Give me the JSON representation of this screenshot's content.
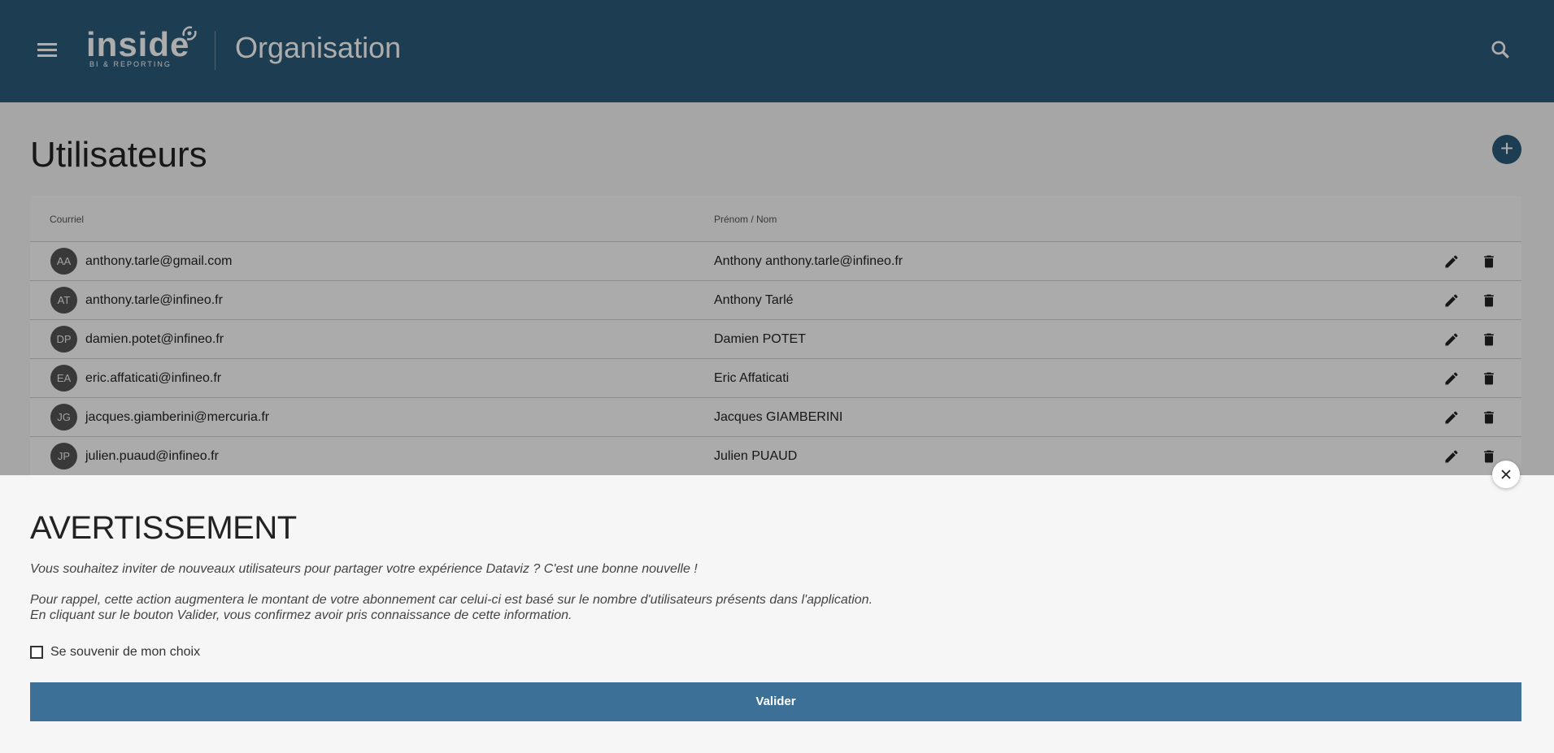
{
  "header": {
    "logo_text": "inside",
    "logo_subtitle": "BI & REPORTING",
    "page_name": "Organisation",
    "color": "#2a5a7a"
  },
  "main": {
    "title": "Utilisateurs",
    "add_label": "+",
    "columns": [
      "Courriel",
      "Prénom / Nom"
    ],
    "rows": [
      {
        "initials": "AA",
        "email": "anthony.tarle@gmail.com",
        "name": "Anthony anthony.tarle@infineo.fr"
      },
      {
        "initials": "AT",
        "email": "anthony.tarle@infineo.fr",
        "name": "Anthony Tarlé"
      },
      {
        "initials": "DP",
        "email": "damien.potet@infineo.fr",
        "name": "Damien POTET"
      },
      {
        "initials": "EA",
        "email": "eric.affaticati@infineo.fr",
        "name": "Eric Affaticati"
      },
      {
        "initials": "JG",
        "email": "jacques.giamberini@mercuria.fr",
        "name": "Jacques GIAMBERINI"
      },
      {
        "initials": "JP",
        "email": "julien.puaud@infineo.fr",
        "name": "Julien PUAUD"
      }
    ]
  },
  "dialog": {
    "title": "AVERTISSEMENT",
    "line1": "Vous souhaitez inviter de nouveaux utilisateurs pour partager votre expérience Dataviz ? C'est une bonne nouvelle !",
    "line2": "Pour rappel, cette action augmentera le montant de votre abonnement car celui-ci est basé sur le nombre d'utilisateurs présents dans l'application.",
    "line3": "En cliquant sur le bouton Valider, vous confirmez avoir pris connaissance de cette information.",
    "remember_label": "Se souvenir de mon choix",
    "validate_label": "Valider",
    "button_color": "#3d7096"
  }
}
